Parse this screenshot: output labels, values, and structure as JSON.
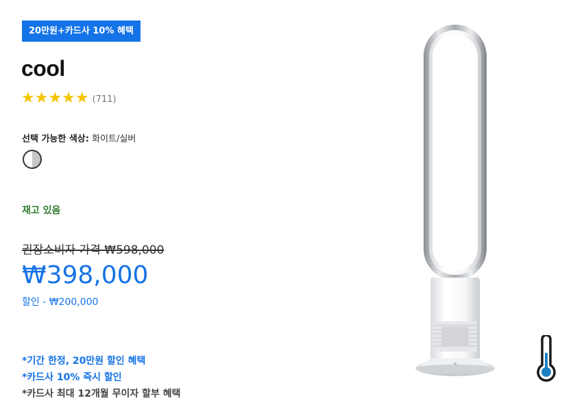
{
  "promo": {
    "badge": "20만원+카드사 10% 혜택"
  },
  "product": {
    "title": "cool",
    "stars": "★★★★★",
    "rating_value": 5,
    "review_count": "(711)"
  },
  "color": {
    "label": "선택 가능한 색상:",
    "value": "화이트/실버"
  },
  "stock": {
    "status": "재고 있음"
  },
  "pricing": {
    "rrp": "권장소비자 가격 ₩598,000",
    "price": "₩398,000",
    "discount": "할인 - ₩200,000"
  },
  "benefits": [
    "*기간 한정, 20만원 할인 혜택",
    "*카드사 10% 즉시 할인",
    "*카드사 최대 12개월 무이자 할부 혜택"
  ],
  "icons": {
    "thermometer": "thermometer-icon"
  },
  "colors": {
    "accent": "#1473e6",
    "stock_green": "#2f7d32",
    "star": "#f5c400",
    "thermo_fill": "#1d7fc4"
  }
}
